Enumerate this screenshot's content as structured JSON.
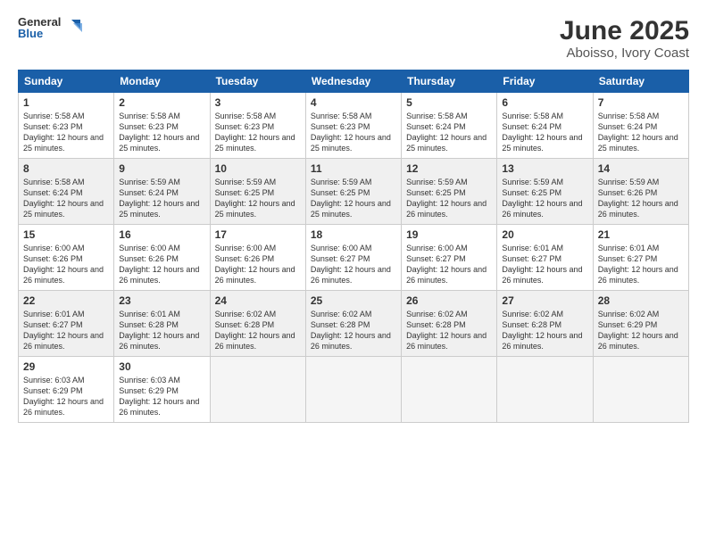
{
  "header": {
    "logo_line1": "General",
    "logo_line2": "Blue",
    "title": "June 2025",
    "subtitle": "Aboisso, Ivory Coast"
  },
  "days_of_week": [
    "Sunday",
    "Monday",
    "Tuesday",
    "Wednesday",
    "Thursday",
    "Friday",
    "Saturday"
  ],
  "weeks": [
    [
      {
        "day": "1",
        "sunrise": "5:58 AM",
        "sunset": "6:23 PM",
        "daylight": "12 hours and 25 minutes."
      },
      {
        "day": "2",
        "sunrise": "5:58 AM",
        "sunset": "6:23 PM",
        "daylight": "12 hours and 25 minutes."
      },
      {
        "day": "3",
        "sunrise": "5:58 AM",
        "sunset": "6:23 PM",
        "daylight": "12 hours and 25 minutes."
      },
      {
        "day": "4",
        "sunrise": "5:58 AM",
        "sunset": "6:23 PM",
        "daylight": "12 hours and 25 minutes."
      },
      {
        "day": "5",
        "sunrise": "5:58 AM",
        "sunset": "6:24 PM",
        "daylight": "12 hours and 25 minutes."
      },
      {
        "day": "6",
        "sunrise": "5:58 AM",
        "sunset": "6:24 PM",
        "daylight": "12 hours and 25 minutes."
      },
      {
        "day": "7",
        "sunrise": "5:58 AM",
        "sunset": "6:24 PM",
        "daylight": "12 hours and 25 minutes."
      }
    ],
    [
      {
        "day": "8",
        "sunrise": "5:58 AM",
        "sunset": "6:24 PM",
        "daylight": "12 hours and 25 minutes."
      },
      {
        "day": "9",
        "sunrise": "5:59 AM",
        "sunset": "6:24 PM",
        "daylight": "12 hours and 25 minutes."
      },
      {
        "day": "10",
        "sunrise": "5:59 AM",
        "sunset": "6:25 PM",
        "daylight": "12 hours and 25 minutes."
      },
      {
        "day": "11",
        "sunrise": "5:59 AM",
        "sunset": "6:25 PM",
        "daylight": "12 hours and 25 minutes."
      },
      {
        "day": "12",
        "sunrise": "5:59 AM",
        "sunset": "6:25 PM",
        "daylight": "12 hours and 26 minutes."
      },
      {
        "day": "13",
        "sunrise": "5:59 AM",
        "sunset": "6:25 PM",
        "daylight": "12 hours and 26 minutes."
      },
      {
        "day": "14",
        "sunrise": "5:59 AM",
        "sunset": "6:26 PM",
        "daylight": "12 hours and 26 minutes."
      }
    ],
    [
      {
        "day": "15",
        "sunrise": "6:00 AM",
        "sunset": "6:26 PM",
        "daylight": "12 hours and 26 minutes."
      },
      {
        "day": "16",
        "sunrise": "6:00 AM",
        "sunset": "6:26 PM",
        "daylight": "12 hours and 26 minutes."
      },
      {
        "day": "17",
        "sunrise": "6:00 AM",
        "sunset": "6:26 PM",
        "daylight": "12 hours and 26 minutes."
      },
      {
        "day": "18",
        "sunrise": "6:00 AM",
        "sunset": "6:27 PM",
        "daylight": "12 hours and 26 minutes."
      },
      {
        "day": "19",
        "sunrise": "6:00 AM",
        "sunset": "6:27 PM",
        "daylight": "12 hours and 26 minutes."
      },
      {
        "day": "20",
        "sunrise": "6:01 AM",
        "sunset": "6:27 PM",
        "daylight": "12 hours and 26 minutes."
      },
      {
        "day": "21",
        "sunrise": "6:01 AM",
        "sunset": "6:27 PM",
        "daylight": "12 hours and 26 minutes."
      }
    ],
    [
      {
        "day": "22",
        "sunrise": "6:01 AM",
        "sunset": "6:27 PM",
        "daylight": "12 hours and 26 minutes."
      },
      {
        "day": "23",
        "sunrise": "6:01 AM",
        "sunset": "6:28 PM",
        "daylight": "12 hours and 26 minutes."
      },
      {
        "day": "24",
        "sunrise": "6:02 AM",
        "sunset": "6:28 PM",
        "daylight": "12 hours and 26 minutes."
      },
      {
        "day": "25",
        "sunrise": "6:02 AM",
        "sunset": "6:28 PM",
        "daylight": "12 hours and 26 minutes."
      },
      {
        "day": "26",
        "sunrise": "6:02 AM",
        "sunset": "6:28 PM",
        "daylight": "12 hours and 26 minutes."
      },
      {
        "day": "27",
        "sunrise": "6:02 AM",
        "sunset": "6:28 PM",
        "daylight": "12 hours and 26 minutes."
      },
      {
        "day": "28",
        "sunrise": "6:02 AM",
        "sunset": "6:29 PM",
        "daylight": "12 hours and 26 minutes."
      }
    ],
    [
      {
        "day": "29",
        "sunrise": "6:03 AM",
        "sunset": "6:29 PM",
        "daylight": "12 hours and 26 minutes."
      },
      {
        "day": "30",
        "sunrise": "6:03 AM",
        "sunset": "6:29 PM",
        "daylight": "12 hours and 26 minutes."
      },
      null,
      null,
      null,
      null,
      null
    ]
  ]
}
